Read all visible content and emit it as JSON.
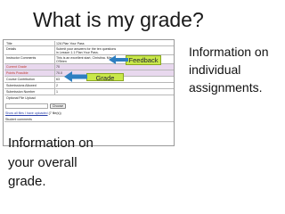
{
  "slide": {
    "title": "What is my grade?",
    "right_text": [
      "Information on",
      "individual",
      "assignments."
    ],
    "bottom_text": [
      "Information on",
      "your overall",
      "grade."
    ]
  },
  "callouts": {
    "feedback": "Feedback",
    "grade": "Grade"
  },
  "assignment_table": {
    "rows": [
      {
        "label": "Title",
        "value": "12A Plan Your Pass"
      },
      {
        "label": "Details",
        "value": "Submit your answers for the ten questions in Lesson 1.1 Plan Your Pass."
      },
      {
        "label": "Instructor Comments",
        "value": "This is an excellent start, Christina. Mrs. O'Brien"
      },
      {
        "label": "Current Grade",
        "value": "70"
      },
      {
        "label": "Points Possible",
        "value": "70.0"
      },
      {
        "label": "Course Contribution",
        "value": "63"
      },
      {
        "label": "Submissions Allowed",
        "value": "2"
      },
      {
        "label": "Submission Number",
        "value": "1"
      },
      {
        "label": "Optional File Upload",
        "value": ""
      }
    ],
    "choose_button": "Choose",
    "show_files_link": "Show all files I have uploaded",
    "show_files_count": "(7 file(s))",
    "student_comments_label": "Student comments"
  },
  "colors": {
    "callout_fill": "#c9e84a",
    "highlight_row": "#e8d8ee",
    "arrow": "#2e7fc1"
  }
}
